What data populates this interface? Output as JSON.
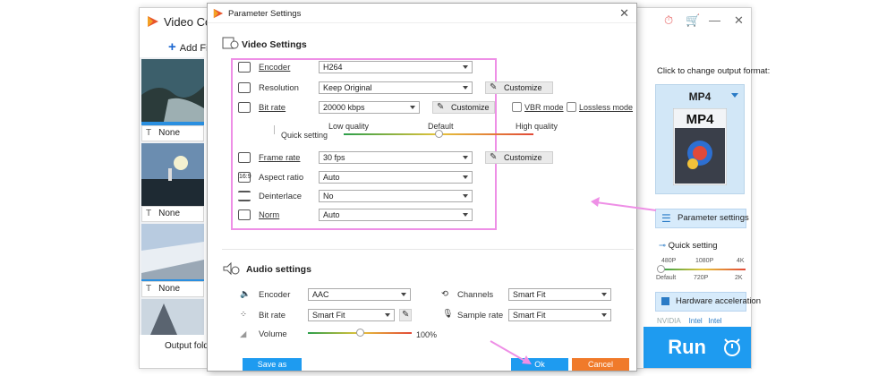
{
  "main_window": {
    "title": "Video Conv",
    "add_files_label": "Add Files",
    "clips": [
      {
        "subtitle": "None"
      },
      {
        "subtitle": "None"
      },
      {
        "subtitle": "None"
      }
    ],
    "output_folder_label": "Output folder:",
    "format_hint": "Click to change output format:",
    "format_name": "MP4",
    "format_icon_text": "MP4",
    "parameter_settings_label": "Parameter settings",
    "quick_setting_label": "Quick setting",
    "quick_setting_ticks_top": [
      "480P",
      "1080P",
      "4K"
    ],
    "quick_setting_ticks_bottom": [
      "Default",
      "720P",
      "2K"
    ],
    "hardware_acceleration_label": "Hardware acceleration",
    "gpu_labels": [
      "NVIDIA",
      "Intel",
      "Intel"
    ],
    "run_label": "Run"
  },
  "dialog": {
    "title": "Parameter Settings",
    "video_section_title": "Video Settings",
    "video": {
      "encoder_label": "Encoder",
      "encoder_value": "H264",
      "resolution_label": "Resolution",
      "resolution_value": "Keep Original",
      "resolution_customize": "Customize",
      "bitrate_label": "Bit rate",
      "bitrate_value": "20000 kbps",
      "bitrate_customize": "Customize",
      "vbr_label": "VBR mode",
      "lossless_label": "Lossless mode",
      "quality_low": "Low quality",
      "quality_default": "Default",
      "quality_high": "High quality",
      "quick_setting_label": "Quick setting",
      "quality_position": 0.5,
      "framerate_label": "Frame rate",
      "framerate_value": "30 fps",
      "framerate_customize": "Customize",
      "aspect_label": "Aspect ratio",
      "aspect_value": "Auto",
      "deinterlace_label": "Deinterlace",
      "deinterlace_value": "No",
      "norm_label": "Norm",
      "norm_value": "Auto"
    },
    "audio_section_title": "Audio settings",
    "audio": {
      "encoder_label": "Encoder",
      "encoder_value": "AAC",
      "channels_label": "Channels",
      "channels_value": "Smart Fit",
      "bitrate_label": "Bit rate",
      "bitrate_value": "Smart Fit",
      "samplerate_label": "Sample rate",
      "samplerate_value": "Smart Fit",
      "volume_label": "Volume",
      "volume_value": "100%",
      "volume_position": 0.5
    },
    "save_as_label": "Save as",
    "ok_label": "Ok",
    "cancel_label": "Cancel"
  },
  "colors": {
    "accent_blue": "#1e9bf0",
    "cancel_orange": "#f07a2a",
    "highlight_pink": "#ee8fe6"
  }
}
